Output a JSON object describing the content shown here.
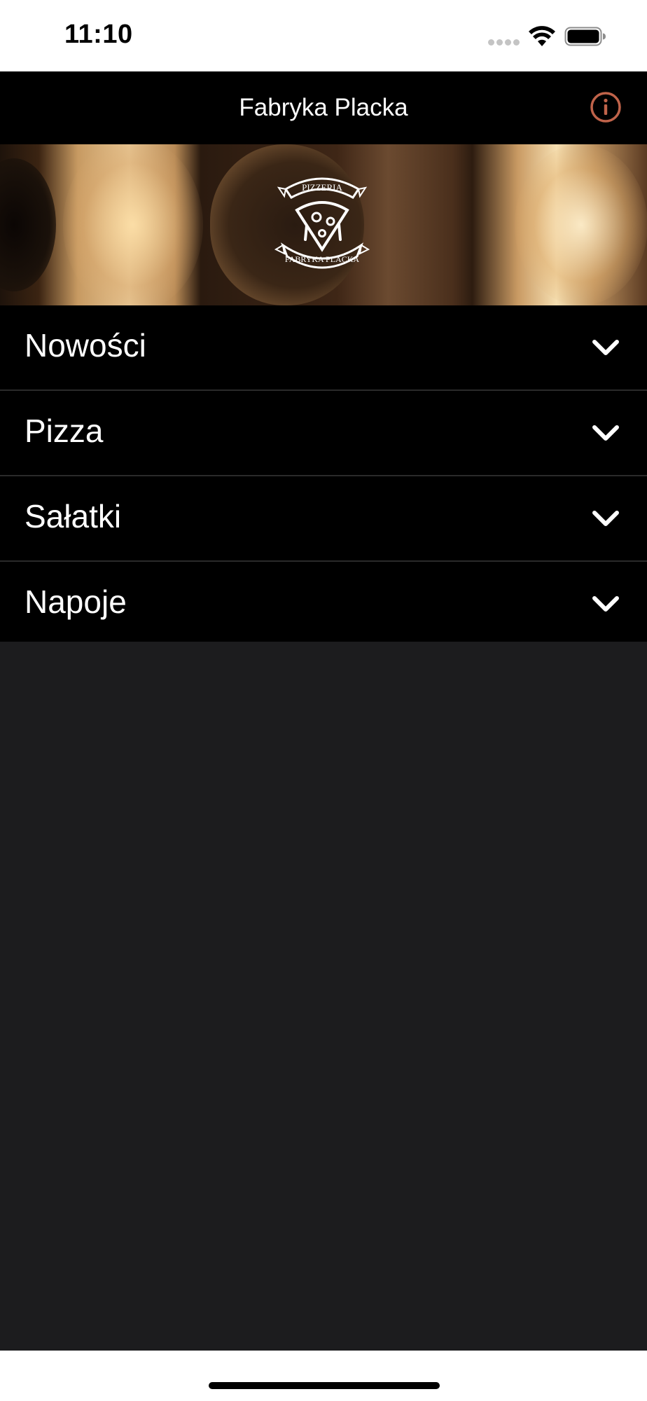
{
  "status_bar": {
    "time": "11:10",
    "icons": [
      "cellular-signal-icon",
      "wifi-icon",
      "battery-icon"
    ]
  },
  "nav_bar": {
    "title": "Fabryka Placka",
    "info_icon": "info-icon",
    "accent_color": "#c0634a"
  },
  "banner": {
    "logo_top_text": "PIZZERIA",
    "logo_bottom_text": "FABRYKA PLACKA"
  },
  "menu": {
    "items": [
      {
        "label": "Nowości",
        "icon": "chevron-down-icon"
      },
      {
        "label": "Pizza",
        "icon": "chevron-down-icon"
      },
      {
        "label": "Sałatki",
        "icon": "chevron-down-icon"
      },
      {
        "label": "Napoje",
        "icon": "chevron-down-icon"
      }
    ]
  },
  "colors": {
    "background": "#1c1c1e",
    "list_background": "#000000",
    "text": "#ffffff"
  }
}
